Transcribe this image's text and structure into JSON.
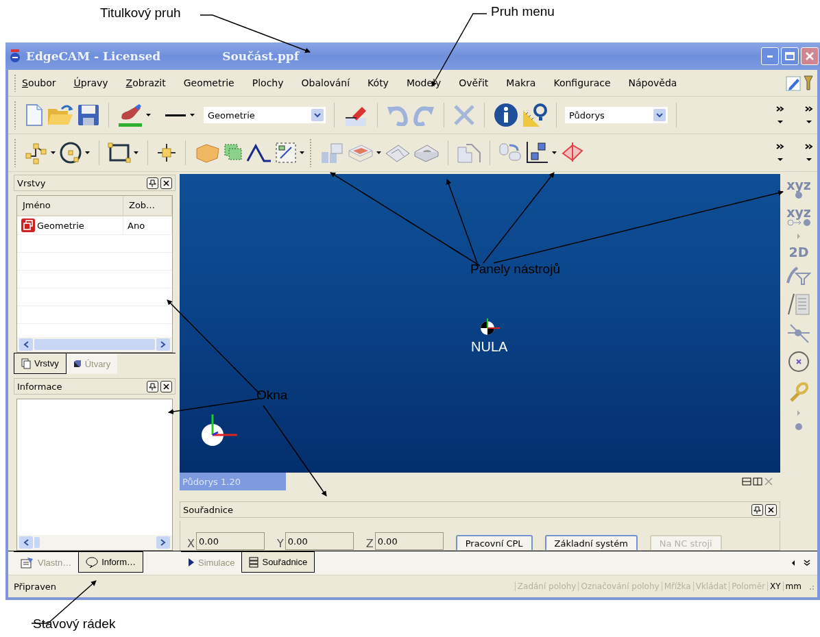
{
  "annotations": [
    {
      "kind": "title",
      "text": "Titulkový pruh"
    },
    {
      "kind": "menu",
      "text": "Pruh menu"
    },
    {
      "kind": "toolbars",
      "text": "Panely nástrojů"
    },
    {
      "kind": "windows",
      "text": "Okna"
    },
    {
      "kind": "status",
      "text": "Stavový rádek"
    }
  ],
  "window": {
    "title": "EdgeCAM - Licensed",
    "document": "Součást.ppf"
  },
  "menu": [
    {
      "label": "Soubor",
      "mnemonic": true
    },
    {
      "label": "Úpravy",
      "mnemonic": true
    },
    {
      "label": "Zobrazit",
      "mnemonic": true
    },
    {
      "label": "Geometrie",
      "mnemonic": false
    },
    {
      "label": "Plochy",
      "mnemonic": false
    },
    {
      "label": "Obalování",
      "mnemonic": false
    },
    {
      "label": "Kóty",
      "mnemonic": false
    },
    {
      "label": "Modely",
      "mnemonic": false
    },
    {
      "label": "Ověřit",
      "mnemonic": false
    },
    {
      "label": "Makra",
      "mnemonic": false
    },
    {
      "label": "Konfigurace",
      "mnemonic": false
    },
    {
      "label": "Nápověda",
      "mnemonic": false
    }
  ],
  "toolbar": {
    "layer_select": "Geometrie",
    "view_select": "Půdorys"
  },
  "layers_panel": {
    "title": "Vrstvy",
    "columns": [
      "Jméno",
      "Zob…"
    ],
    "rows": [
      {
        "name": "Geometrie",
        "shown": "Ano"
      }
    ],
    "tabs": [
      {
        "label": "Vrstvy",
        "selected": true
      },
      {
        "label": "Útvary",
        "selected": false
      }
    ]
  },
  "info_panel": {
    "title": "Informace",
    "tabs": [
      {
        "label": "Vlastn…",
        "selected": false
      },
      {
        "label": "Inform…",
        "selected": true
      }
    ]
  },
  "viewport": {
    "origin_label": "NULA",
    "view_label": "Půdorys 1.20"
  },
  "right_toolbar": [
    {
      "kind": "label",
      "text": "xyz"
    },
    {
      "kind": "label",
      "text": "xyz"
    },
    {
      "kind": "label",
      "text": "2D"
    }
  ],
  "coordinates_panel": {
    "title": "Souřadnice",
    "fields": [
      {
        "axis": "X",
        "value": "0.00"
      },
      {
        "axis": "Y",
        "value": "0.00"
      },
      {
        "axis": "Z",
        "value": "0.00"
      }
    ],
    "buttons": [
      {
        "label": "Pracovní CPL",
        "disabled": false
      },
      {
        "label": "Základní systém",
        "disabled": false
      },
      {
        "label": "Na NC stroji",
        "disabled": true
      }
    ]
  },
  "bottom_tabs": [
    {
      "label": "Simulace",
      "selected": false
    },
    {
      "label": "Souřadnice",
      "selected": true
    }
  ],
  "status_bar": {
    "message": "Připraven",
    "indicators": [
      {
        "label": "Zadání polohy",
        "on": false
      },
      {
        "label": "Označování polohy",
        "on": false
      },
      {
        "label": "Mřížka",
        "on": false
      },
      {
        "label": "Vkládat",
        "on": false
      },
      {
        "label": "Poloměr",
        "on": false
      },
      {
        "label": "XY",
        "on": true
      },
      {
        "label": "mm",
        "on": true
      }
    ]
  }
}
